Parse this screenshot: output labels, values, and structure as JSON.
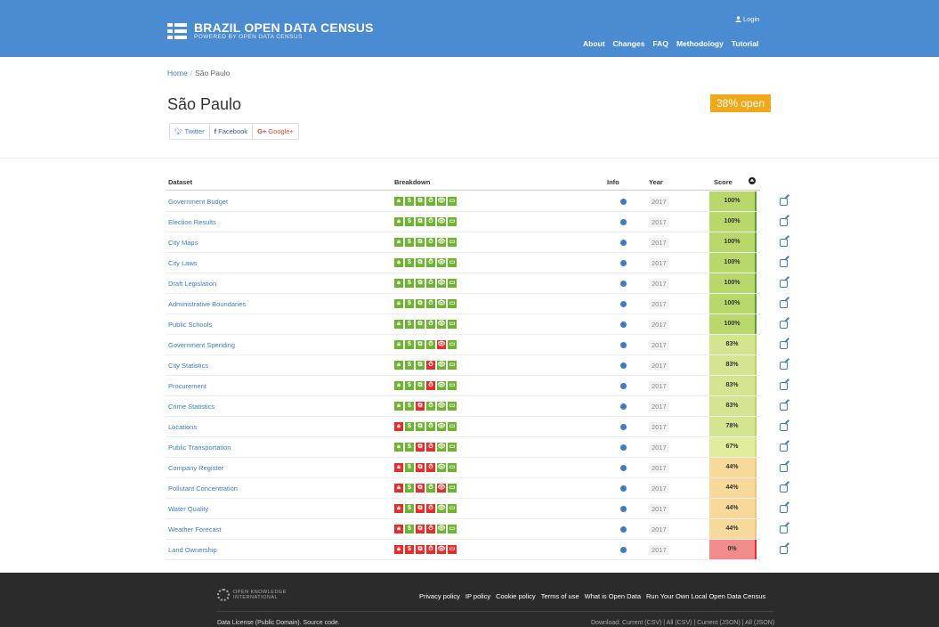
{
  "header": {
    "title": "BRAZIL OPEN DATA CENSUS",
    "subtitle": "POWERED BY OPEN DATA CENSUS",
    "login": "Login",
    "nav": [
      "About",
      "Changes",
      "FAQ",
      "Methodology",
      "Tutorial"
    ]
  },
  "breadcrumb": {
    "home": "Home",
    "current": "São Paulo"
  },
  "page": {
    "title": "São Paulo",
    "open_badge": "38% open"
  },
  "share": {
    "twitter": "Twitter",
    "facebook": "Facebook",
    "google": "Google+"
  },
  "table": {
    "headers": {
      "dataset": "Dataset",
      "breakdown": "Breakdown",
      "info": "Info",
      "year": "Year",
      "score": "Score"
    },
    "rows": [
      {
        "name": "Government Budget",
        "breakdown": [
          "g",
          "g",
          "g",
          "g",
          "g",
          "g"
        ],
        "year": "2017",
        "score": "100%",
        "score_color": "#b8d86b",
        "bar_color": "#5aa02c"
      },
      {
        "name": "Election Results",
        "breakdown": [
          "g",
          "g",
          "g",
          "g",
          "g",
          "g"
        ],
        "year": "2017",
        "score": "100%",
        "score_color": "#b8d86b",
        "bar_color": "#5aa02c"
      },
      {
        "name": "City Maps",
        "breakdown": [
          "g",
          "g",
          "g",
          "g",
          "g",
          "g"
        ],
        "year": "2017",
        "score": "100%",
        "score_color": "#b8d86b",
        "bar_color": "#5aa02c"
      },
      {
        "name": "City Laws",
        "breakdown": [
          "g",
          "g",
          "g",
          "g",
          "g",
          "g"
        ],
        "year": "2017",
        "score": "100%",
        "score_color": "#b8d86b",
        "bar_color": "#5aa02c"
      },
      {
        "name": "Draft Legislation",
        "breakdown": [
          "g",
          "g",
          "g",
          "g",
          "g",
          "g"
        ],
        "year": "2017",
        "score": "100%",
        "score_color": "#b8d86b",
        "bar_color": "#5aa02c"
      },
      {
        "name": "Administrative Boundaries",
        "breakdown": [
          "g",
          "g",
          "g",
          "g",
          "g",
          "g"
        ],
        "year": "2017",
        "score": "100%",
        "score_color": "#b8d86b",
        "bar_color": "#5aa02c"
      },
      {
        "name": "Public Schools",
        "breakdown": [
          "g",
          "g",
          "g",
          "g",
          "g",
          "g"
        ],
        "year": "2017",
        "score": "100%",
        "score_color": "#b8d86b",
        "bar_color": "#5aa02c"
      },
      {
        "name": "Government Spending",
        "breakdown": [
          "g",
          "g",
          "g",
          "g",
          "r",
          "g"
        ],
        "year": "2017",
        "score": "83%",
        "score_color": "#d4e592",
        "bar_color": "#b9d45a"
      },
      {
        "name": "City Statistics",
        "breakdown": [
          "g",
          "g",
          "g",
          "r",
          "g",
          "g"
        ],
        "year": "2017",
        "score": "83%",
        "score_color": "#d4e592",
        "bar_color": "#b9d45a"
      },
      {
        "name": "Procurement",
        "breakdown": [
          "g",
          "g",
          "g",
          "r",
          "g",
          "g"
        ],
        "year": "2017",
        "score": "83%",
        "score_color": "#d4e592",
        "bar_color": "#b9d45a"
      },
      {
        "name": "Crime Statistics",
        "breakdown": [
          "g",
          "g",
          "r",
          "g",
          "g",
          "g"
        ],
        "year": "2017",
        "score": "83%",
        "score_color": "#d4e592",
        "bar_color": "#b9d45a"
      },
      {
        "name": "Locations",
        "breakdown": [
          "r",
          "g",
          "g",
          "g",
          "g",
          "g"
        ],
        "year": "2017",
        "score": "78%",
        "score_color": "#d4e592",
        "bar_color": "#b9d45a"
      },
      {
        "name": "Public Transportation",
        "breakdown": [
          "g",
          "g",
          "r",
          "r",
          "g",
          "g"
        ],
        "year": "2017",
        "score": "67%",
        "score_color": "#e3eb9c",
        "bar_color": "#d2dd78"
      },
      {
        "name": "Company Register",
        "breakdown": [
          "r",
          "g",
          "r",
          "r",
          "g",
          "g"
        ],
        "year": "2017",
        "score": "44%",
        "score_color": "#f7d99b",
        "bar_color": "#f0c67a"
      },
      {
        "name": "Pollutant Concentration",
        "breakdown": [
          "r",
          "g",
          "r",
          "g",
          "r",
          "g"
        ],
        "year": "2017",
        "score": "44%",
        "score_color": "#f7d99b",
        "bar_color": "#f0c67a"
      },
      {
        "name": "Water Quality",
        "breakdown": [
          "r",
          "g",
          "r",
          "r",
          "g",
          "g"
        ],
        "year": "2017",
        "score": "44%",
        "score_color": "#f7d99b",
        "bar_color": "#f0c67a"
      },
      {
        "name": "Weather Forecast",
        "breakdown": [
          "r",
          "g",
          "r",
          "r",
          "g",
          "g"
        ],
        "year": "2017",
        "score": "44%",
        "score_color": "#f7d99b",
        "bar_color": "#f0c67a"
      },
      {
        "name": "Land Ownership",
        "breakdown": [
          "r",
          "r",
          "r",
          "r",
          "r",
          "r"
        ],
        "year": "2017",
        "score": "0%",
        "score_color": "#f28c8c",
        "bar_color": "#e82b2b"
      }
    ]
  },
  "footer": {
    "org_line1": "OPEN KNOWLEDGE",
    "org_line2": "INTERNATIONAL",
    "links": [
      "Privacy policy",
      "IP policy",
      "Cookie policy",
      "Terms of use",
      "What is Open Data",
      "Run Your Own Local Open Data Census"
    ],
    "left_text": "Data License (Public Domain). Source code.",
    "right_text": "Download: Current (CSV) | All (CSV) | Current (JSON) | All (JSON)"
  }
}
